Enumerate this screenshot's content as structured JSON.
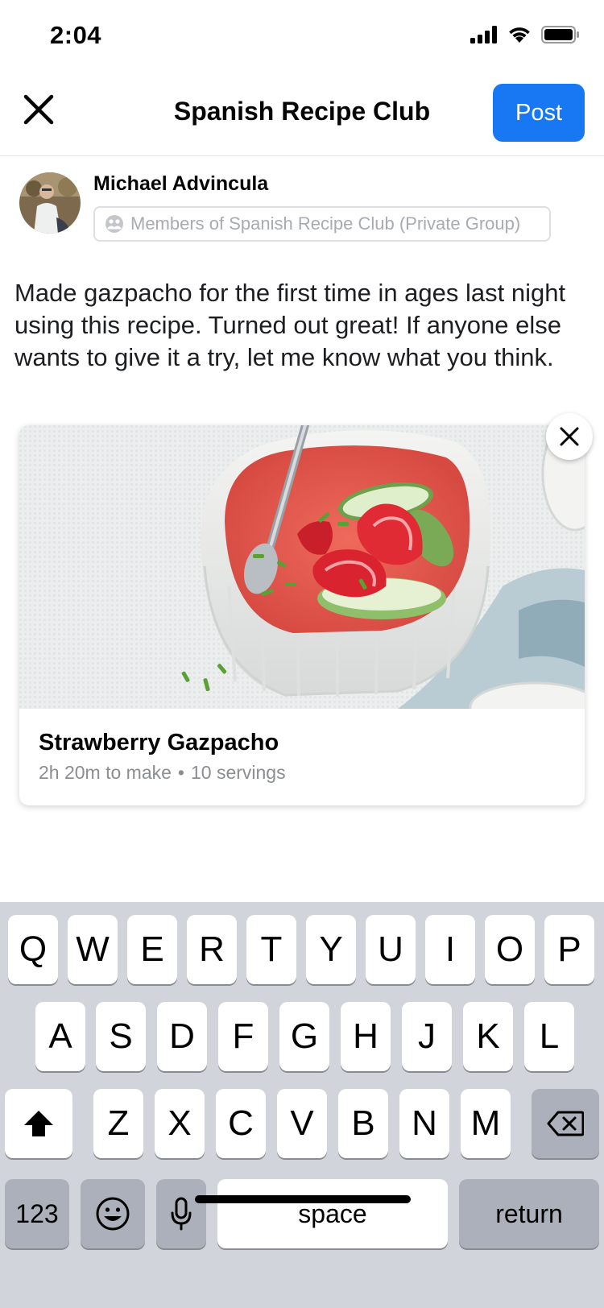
{
  "status_bar": {
    "time": "2:04"
  },
  "header": {
    "title": "Spanish Recipe Club",
    "post_label": "Post"
  },
  "author": {
    "name": "Michael Advincula",
    "audience": "Members of Spanish Recipe Club (Private Group)"
  },
  "post": {
    "text": "Made gazpacho for the first time in ages last night using this recipe. Turned out great! If anyone else wants to give it a try, let me know what you think."
  },
  "recipe_card": {
    "title": "Strawberry Gazpacho",
    "time": "2h 20m to make",
    "separator": "•",
    "servings": "10 servings"
  },
  "keyboard": {
    "row1": [
      "Q",
      "W",
      "E",
      "R",
      "T",
      "Y",
      "U",
      "I",
      "O",
      "P"
    ],
    "row2": [
      "A",
      "S",
      "D",
      "F",
      "G",
      "H",
      "J",
      "K",
      "L"
    ],
    "row3": [
      "Z",
      "X",
      "C",
      "V",
      "B",
      "N",
      "M"
    ],
    "numbers_label": "123",
    "space_label": "space",
    "return_label": "return"
  },
  "icons": {
    "close": "close-icon",
    "audience": "group-icon",
    "remove": "close-icon",
    "shift": "shift-icon",
    "backspace": "backspace-icon",
    "emoji": "emoji-icon",
    "mic": "microphone-icon"
  },
  "colors": {
    "accent": "#1877f2",
    "keyboard_bg": "#d1d4da",
    "dark_key": "#abb0ba"
  }
}
